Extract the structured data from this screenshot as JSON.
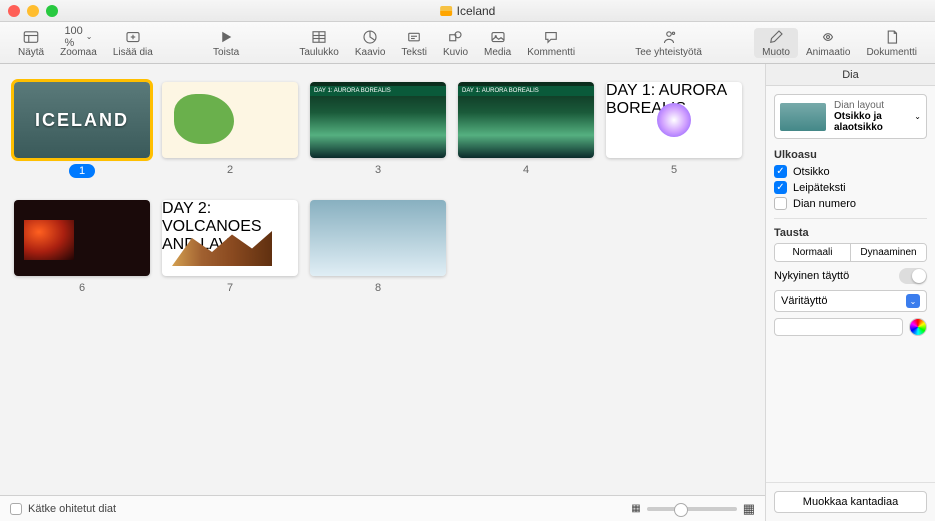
{
  "window": {
    "title": "Iceland"
  },
  "toolbar": {
    "view": "Näytä",
    "zoom": "Zoomaa",
    "zoom_value": "100 %",
    "add_slide": "Lisää dia",
    "play": "Toista",
    "table": "Taulukko",
    "chart": "Kaavio",
    "text": "Teksti",
    "shape": "Kuvio",
    "media": "Media",
    "comment": "Kommentti",
    "collaborate": "Tee yhteistyötä",
    "format": "Muoto",
    "animate": "Animaatio",
    "document": "Dokumentti"
  },
  "slides": [
    {
      "num": "1",
      "title": "ICELAND",
      "kind": "iceland",
      "selected": true
    },
    {
      "num": "2",
      "title": "",
      "kind": "map"
    },
    {
      "num": "3",
      "title": "DAY 1: AURORA BOREALIS",
      "kind": "aurora"
    },
    {
      "num": "4",
      "title": "DAY 1: AURORA BOREALIS",
      "kind": "aurora"
    },
    {
      "num": "5",
      "title": "DAY 1: AURORA BOREALIS",
      "kind": "diagram"
    },
    {
      "num": "6",
      "title": "",
      "kind": "volcano"
    },
    {
      "num": "7",
      "title": "DAY 2: VOLCANOES AND LAVA",
      "kind": "cross"
    },
    {
      "num": "8",
      "title": "",
      "kind": "ice"
    }
  ],
  "bottom": {
    "hide_skipped": "Kätke ohitetut diat"
  },
  "inspector": {
    "tab": "Dia",
    "layout_label": "Dian layout",
    "layout_value": "Otsikko ja alaotsikko",
    "appearance": "Ulkoasu",
    "opt_title": "Otsikko",
    "opt_body": "Leipäteksti",
    "opt_slidenum": "Dian numero",
    "background": "Tausta",
    "seg_normal": "Normaali",
    "seg_dynamic": "Dynaaminen",
    "current_fill": "Nykyinen täyttö",
    "fill_type": "Väritäyttö",
    "edit_master": "Muokkaa kantadiaa"
  }
}
